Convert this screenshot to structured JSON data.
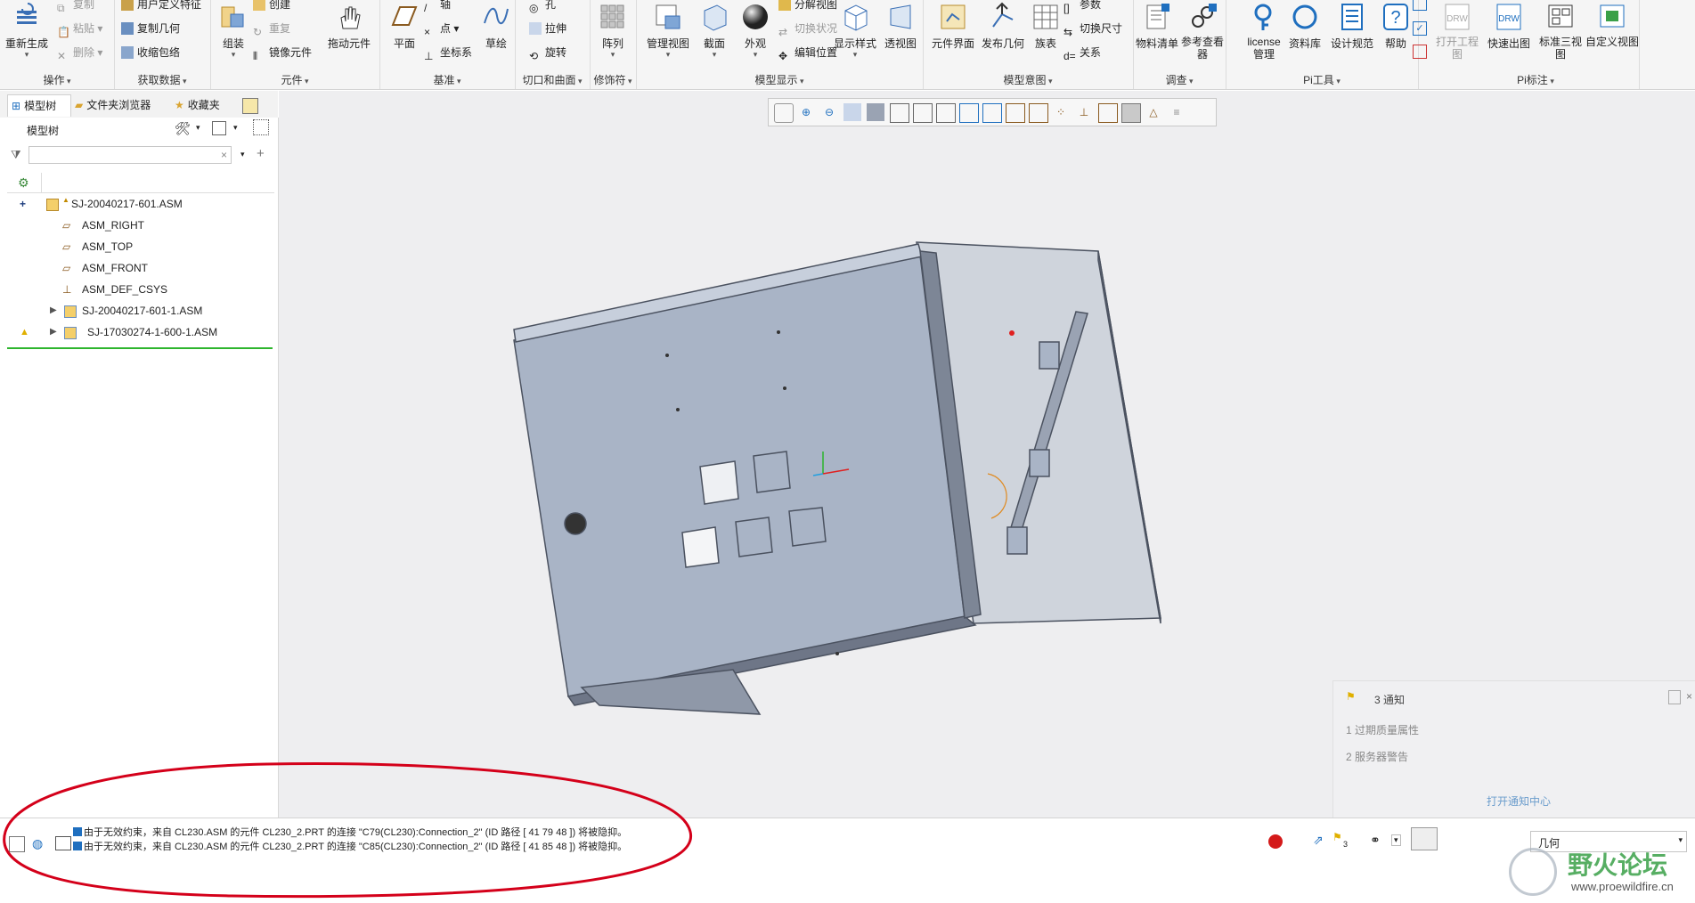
{
  "ribbon": {
    "groups": {
      "operations": {
        "label": "操作",
        "regenerate": "重新生成",
        "copy": "复制",
        "paste": "粘贴",
        "delete": "删除"
      },
      "get_data": {
        "label": "获取数据",
        "user_feature": "用户定义特征",
        "copy_geometry": "复制几何",
        "shrinkwrap": "收缩包络"
      },
      "component": {
        "label": "元件",
        "assemble": "组装",
        "create": "创建",
        "repeat": "重复",
        "mirror": "镜像元件",
        "drag": "拖动元件"
      },
      "datum": {
        "label": "基准",
        "plane": "平面",
        "axis": "轴",
        "point": "点",
        "csys": "坐标系",
        "sketch": "草绘"
      },
      "cut_surface": {
        "label": "切口和曲面",
        "hole": "孔",
        "extrude": "拉伸",
        "revolve": "旋转"
      },
      "modifiers": {
        "label": "修饰符",
        "pattern": "阵列"
      },
      "model_display": {
        "label": "模型显示",
        "manage_views": "管理视图",
        "section": "截面",
        "appearance": "外观",
        "explode": "分解视图",
        "toggle_state": "切换状况",
        "edit_position": "编辑位置",
        "display_style": "显示样式",
        "perspective": "透视图"
      },
      "model_intent": {
        "label": "模型意图",
        "component_interface": "元件界面",
        "publish_geometry": "发布几何",
        "family_table": "族表",
        "parameters": "参数",
        "switch_dims": "切换尺寸",
        "relations": "关系"
      },
      "investigate": {
        "label": "调查",
        "bom": "物料清单",
        "reference_viewer": "参考查看器"
      },
      "pi_tools": {
        "label": "Pi工具",
        "license": "license管理",
        "library": "资料库",
        "design_spec": "设计规范",
        "help": "帮助"
      },
      "pi_annotate": {
        "label": "Pi标注",
        "open_drawing": "打开工程图",
        "quick_drawing": "快速出图",
        "std_views": "标准三视图",
        "custom_view": "自定义视图"
      }
    }
  },
  "tabs": {
    "model_tree": "模型树",
    "folder_browser": "文件夹浏览器",
    "favorites": "收藏夹"
  },
  "tree": {
    "header": "模型树",
    "search_placeholder": "",
    "items": [
      {
        "label": "SJ-20040217-601.ASM",
        "icon": "assembly-icon"
      },
      {
        "label": "ASM_RIGHT",
        "icon": "datum-plane-icon"
      },
      {
        "label": "ASM_TOP",
        "icon": "datum-plane-icon"
      },
      {
        "label": "ASM_FRONT",
        "icon": "datum-plane-icon"
      },
      {
        "label": "ASM_DEF_CSYS",
        "icon": "csys-icon"
      },
      {
        "label": "SJ-20040217-601-1.ASM",
        "icon": "assembly-icon"
      },
      {
        "label": "SJ-17030274-1-600-1.ASM",
        "icon": "assembly-icon"
      }
    ]
  },
  "notifications": {
    "title": "3 通知",
    "items": [
      "1 过期质量属性",
      "2 服务器警告"
    ],
    "open_center": "打开通知中心"
  },
  "status": {
    "messages": [
      "由于无效约束，来自 CL230.ASM 的元件 CL230_2.PRT 的连接 \"C79(CL230):Connection_2\" (ID 路径 [ 41 79 48 ]) 将被隐抑。",
      "由于无效约束，来自 CL230.ASM 的元件 CL230_2.PRT 的连接 \"C85(CL230):Connection_2\" (ID 路径 [ 41 85 48 ]) 将被隐抑。"
    ],
    "flag_count": "3",
    "filter_value": "几何"
  },
  "watermark": {
    "title": "野火论坛",
    "url": "www.proewildfire.cn"
  },
  "colors": {
    "accent": "#1f6fbf",
    "highlight_circle": "#d4001a",
    "model_fill": "#a9b4c6",
    "model_edge": "#4b5260"
  }
}
